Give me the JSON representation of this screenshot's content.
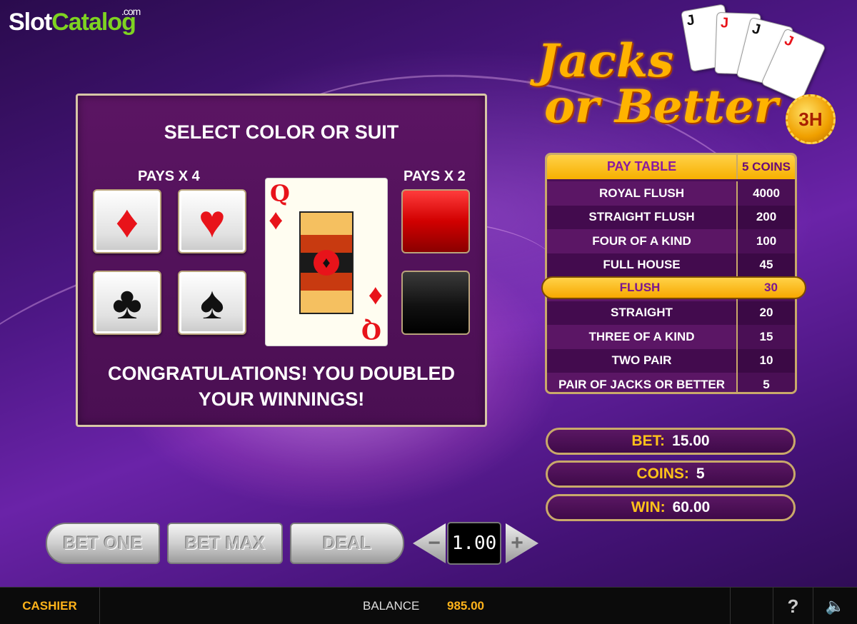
{
  "branding": {
    "site_word1": "Slot",
    "site_word2": "Catalog",
    "site_tld": ".com"
  },
  "game": {
    "title_line1": "Jacks",
    "title_line2": "or Better",
    "badge": "3H"
  },
  "gamble": {
    "title": "SELECT COLOR OR SUIT",
    "pays_suit": "PAYS X 4",
    "pays_color": "PAYS X 2",
    "card": {
      "rank": "Q",
      "suit": "♦"
    },
    "message_line1": "CONGRATULATIONS! YOU DOUBLED",
    "message_line2": "YOUR WINNINGS!",
    "suits": [
      "♦",
      "♥",
      "♣",
      "♠"
    ],
    "colors": [
      "red",
      "black"
    ]
  },
  "paytable": {
    "header_hand": "PAY TABLE",
    "header_pay": "5 COINS",
    "rows": [
      {
        "hand": "ROYAL FLUSH",
        "pay": "4000"
      },
      {
        "hand": "STRAIGHT FLUSH",
        "pay": "200"
      },
      {
        "hand": "FOUR OF A KIND",
        "pay": "100"
      },
      {
        "hand": "FULL HOUSE",
        "pay": "45"
      },
      {
        "hand": "FLUSH",
        "pay": "30"
      },
      {
        "hand": "STRAIGHT",
        "pay": "20"
      },
      {
        "hand": "THREE OF A KIND",
        "pay": "15"
      },
      {
        "hand": "TWO PAIR",
        "pay": "10"
      },
      {
        "hand": "PAIR OF  JACKS OR BETTER",
        "pay": "5"
      }
    ],
    "highlighted_index": 4
  },
  "info": {
    "bet_label": "BET:",
    "bet_value": "15.00",
    "coins_label": "COINS:",
    "coins_value": "5",
    "win_label": "WIN:",
    "win_value": "60.00"
  },
  "controls": {
    "bet_one": "BET ONE",
    "bet_max": "BET MAX",
    "deal": "DEAL",
    "minus": "−",
    "plus": "+",
    "denomination": "1.00"
  },
  "statusbar": {
    "cashier": "CASHIER",
    "balance_label": "BALANCE",
    "balance_value": "985.00",
    "help": "?",
    "sound_icon": "speaker-icon"
  },
  "colors": {
    "accent_gold": "#ffc21a",
    "panel_purple": "#5b1563",
    "suit_red": "#e8131a"
  }
}
